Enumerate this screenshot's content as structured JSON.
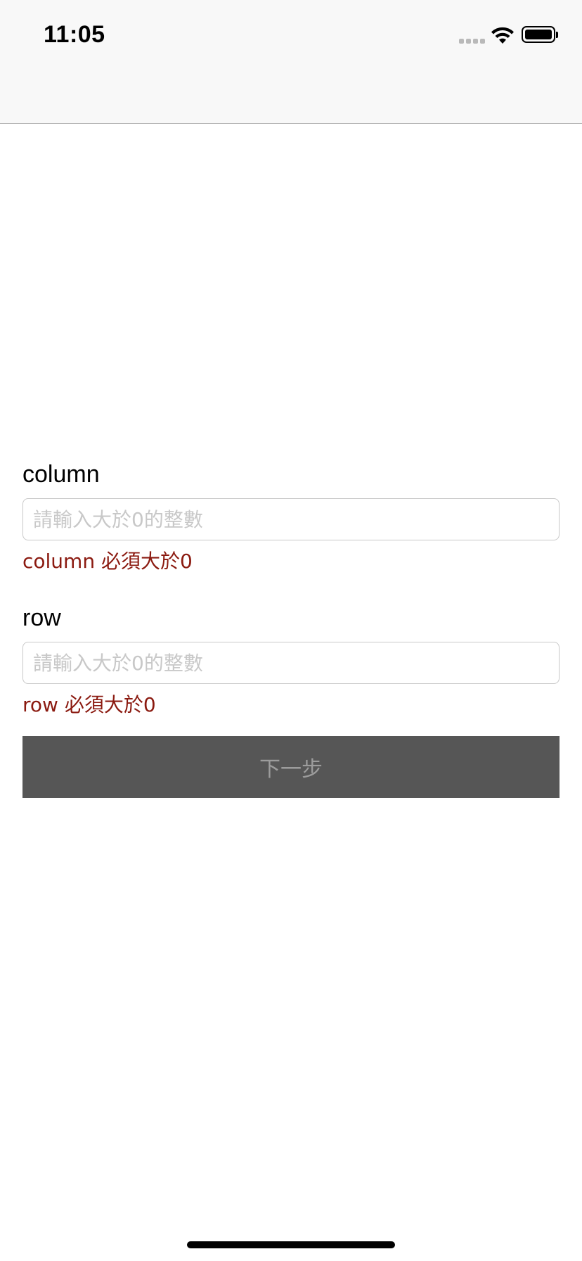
{
  "status_bar": {
    "time": "11:05"
  },
  "form": {
    "column": {
      "label": "column",
      "placeholder": "請輸入大於0的整數",
      "value": "",
      "error": "column 必須大於0"
    },
    "row": {
      "label": "row",
      "placeholder": "請輸入大於0的整數",
      "value": "",
      "error": "row 必須大於0"
    },
    "next_label": "下一步"
  },
  "colors": {
    "error": "#8b1a10",
    "button_bg": "#565656",
    "button_text": "#9c9c9c",
    "top_bar_bg": "#f8f8f8"
  },
  "icons": {
    "signal": "cellular-signal-icon",
    "wifi": "wifi-icon",
    "battery": "battery-icon"
  }
}
